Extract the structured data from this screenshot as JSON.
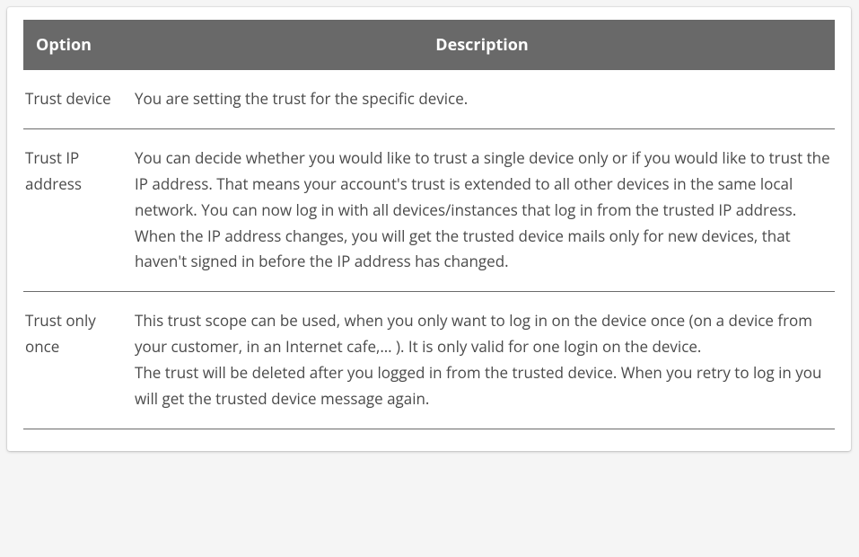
{
  "table": {
    "header": {
      "option": "Option",
      "description": "Description"
    },
    "rows": [
      {
        "option": "Trust device",
        "description": "You are setting the trust for the specific device."
      },
      {
        "option": "Trust IP address",
        "description": "You can decide whether you would like to trust a single device only or if you would like to trust the IP address. That means your account's trust is extended to all other devices in the same local network. You can now log in with all devices/instances that log in from the trusted IP address.\nWhen the IP address changes, you will get the trusted device mails only for new devices, that haven't signed in before the IP address has changed."
      },
      {
        "option": "Trust only once",
        "description": "This trust scope can be used, when you only want to log in on the device once (on a device from your customer, in an Internet cafe,… ). It is only valid for one login on the device.\nThe trust will be deleted after you logged in from the trusted device. When you retry to log in you will get the trusted device message again."
      }
    ]
  }
}
